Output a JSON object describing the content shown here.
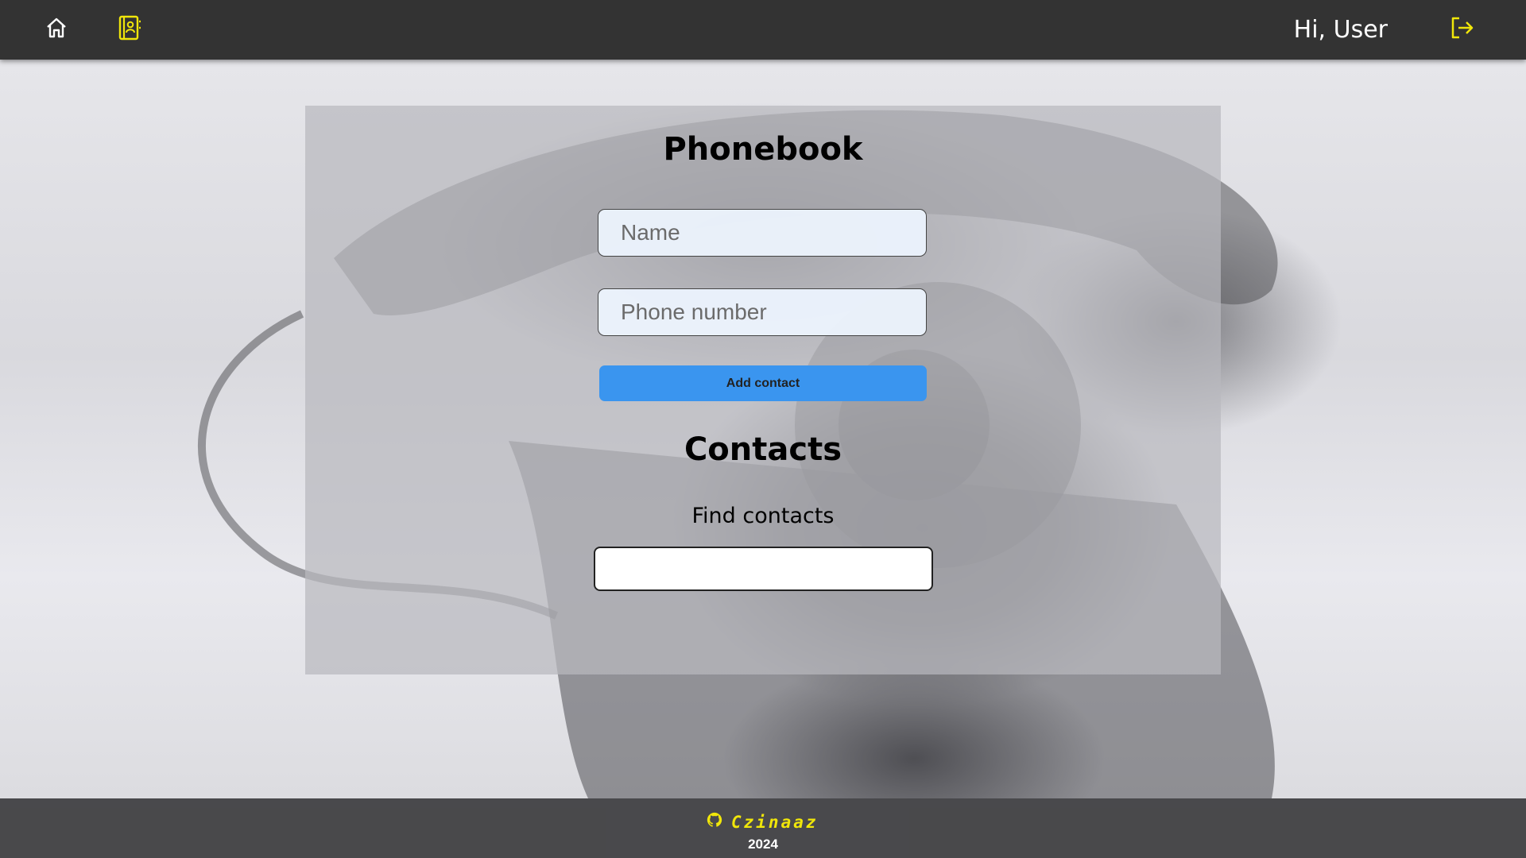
{
  "header": {
    "home_icon": "home-icon",
    "contacts_icon": "contacts-book-icon",
    "greeting": "Hi, User",
    "logout_icon": "logout-icon",
    "accent_color": "#f0e60a"
  },
  "main": {
    "title": "Phonebook",
    "name_placeholder": "Name",
    "phone_placeholder": "Phone number",
    "add_button": "Add contact",
    "contacts_title": "Contacts",
    "filter_label": "Find contacts",
    "filter_value": ""
  },
  "footer": {
    "github_icon": "github-icon",
    "author": "Czinaaz",
    "year": "2024"
  }
}
